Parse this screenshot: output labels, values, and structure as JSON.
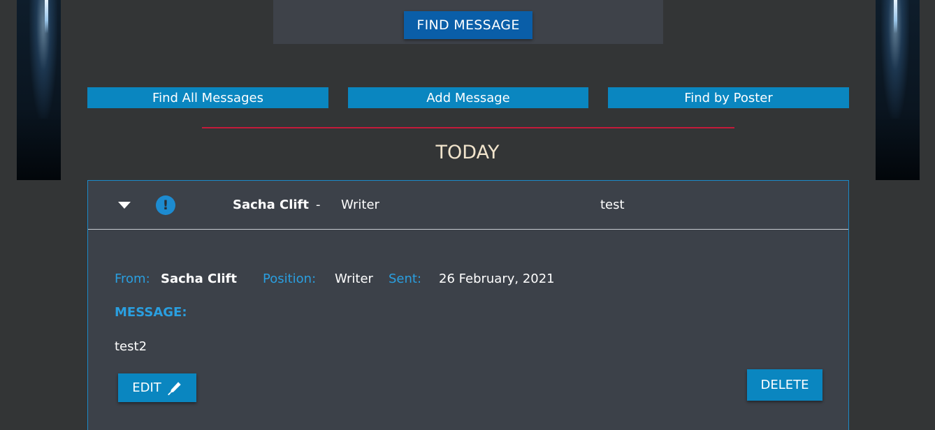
{
  "header": {
    "find_message_label": "FIND MESSAGE"
  },
  "nav": {
    "find_all_label": "Find All Messages",
    "add_label": "Add Message",
    "find_by_poster_label": "Find by Poster"
  },
  "section": {
    "title": "TODAY"
  },
  "message": {
    "summary": {
      "poster_name": "Sacha Clift",
      "separator": "-",
      "position": "Writer",
      "subject": "test",
      "expand_icon": "chevron-down-icon",
      "priority_icon": "exclamation-circle-icon",
      "priority_glyph": "!"
    },
    "details": {
      "from_label": "From:",
      "from_value": "Sacha Clift",
      "position_label": "Position:",
      "position_value": "Writer",
      "sent_label": "Sent:",
      "sent_value": "26 February, 2021",
      "message_label": "MESSAGE:",
      "message_body": "test2"
    },
    "actions": {
      "edit_label": "EDIT",
      "edit_icon": "pen-icon",
      "delete_label": "DELETE"
    }
  },
  "colors": {
    "background": "#333536",
    "panel": "#3e4249",
    "card": "#3c4149",
    "primary_button": "#0a86c0",
    "find_button": "#0a5ea8",
    "label_blue": "#2a9fe0",
    "divider_red": "#c41a3a",
    "title_cream": "#f1e4cc"
  }
}
